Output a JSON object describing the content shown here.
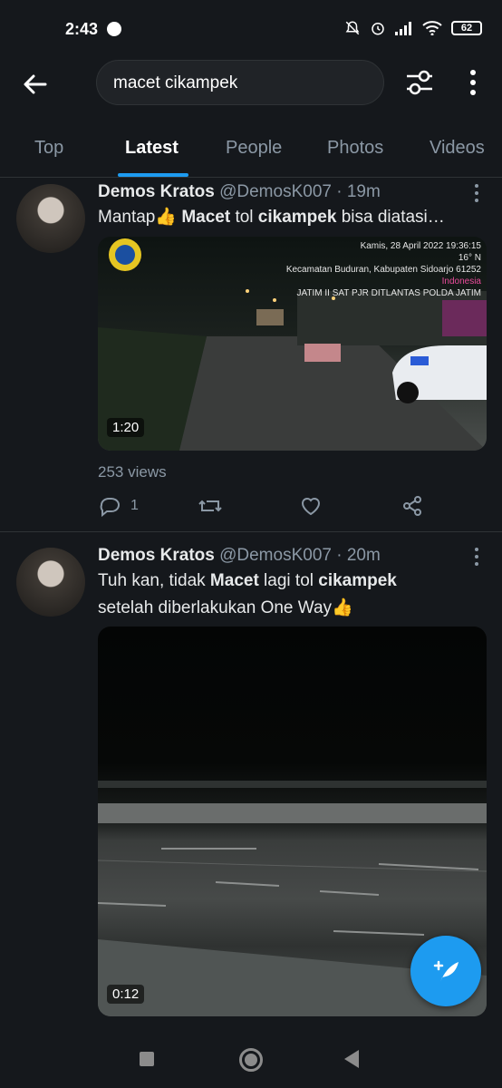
{
  "status_bar": {
    "time": "2:43",
    "battery": "62"
  },
  "search": {
    "query": "macet cikampek"
  },
  "tabs": [
    {
      "label": "Top",
      "active": false
    },
    {
      "label": "Latest",
      "active": true
    },
    {
      "label": "People",
      "active": false
    },
    {
      "label": "Photos",
      "active": false
    },
    {
      "label": "Videos",
      "active": false
    }
  ],
  "tweets": [
    {
      "name": "Demos Kratos",
      "handle": "@DemosK007",
      "time": "19m",
      "text_parts": [
        "Mantap👍 ",
        "Macet",
        " tol ",
        "cikampek",
        " bisa diatasi…"
      ],
      "media": {
        "duration": "1:20",
        "overlay_lines": [
          "Kamis, 28 April 2022 19:36:15",
          "16° N",
          "Kecamatan Buduran, Kabupaten Sidoarjo 61252",
          "Indonesia",
          "JATIM II SAT PJR DITLANTAS POLDA JATIM"
        ]
      },
      "views": "253 views",
      "reply_count": "1"
    },
    {
      "name": "Demos Kratos",
      "handle": "@DemosK007",
      "time": "20m",
      "text_parts": [
        "Tuh kan, tidak ",
        "Macet",
        " lagi tol ",
        "cikampek"
      ],
      "text_line2": "setelah diberlakukan One Way👍",
      "media": {
        "duration": "0:12"
      }
    }
  ],
  "icons": {
    "back": "arrow-left-icon",
    "filter": "sliders-icon",
    "more": "more-vertical-icon",
    "reply": "comment-icon",
    "retweet": "retweet-icon",
    "like": "heart-icon",
    "share": "share-icon",
    "compose": "compose-feather-icon"
  },
  "colors": {
    "background": "#15181c",
    "accent": "#1d9bf0",
    "secondary_text": "#8b98a5"
  }
}
